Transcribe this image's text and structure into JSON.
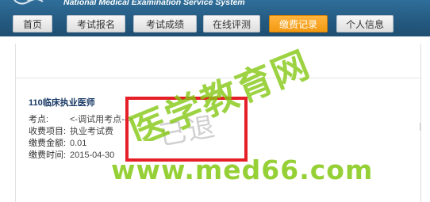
{
  "header": {
    "subtitle": "National Medical Examination Service System"
  },
  "nav": {
    "items": [
      {
        "label": "首页",
        "active": false
      },
      {
        "label": "考试报名",
        "active": false
      },
      {
        "label": "考试成绩",
        "active": false
      },
      {
        "label": "在线评测",
        "active": false
      },
      {
        "label": "缴费记录",
        "active": true
      },
      {
        "label": "个人信息",
        "active": false
      }
    ],
    "active_color": "#f39a12"
  },
  "record": {
    "exam_title": "110临床执业医师",
    "site_label": "考点:",
    "site_value": "<-调试用考点-->",
    "item_label": "收费项目:",
    "item_value": "执业考试费",
    "amount_label": "缴费金额:",
    "amount_value": "0.01",
    "time_label": "缴费时间:",
    "time_value": "2015-04-30"
  },
  "stamp": {
    "text": "已退",
    "border_color": "#e51f27"
  },
  "watermark": {
    "name": "医学教育网",
    "url": "www.med66.com",
    "color": "#84c814"
  }
}
